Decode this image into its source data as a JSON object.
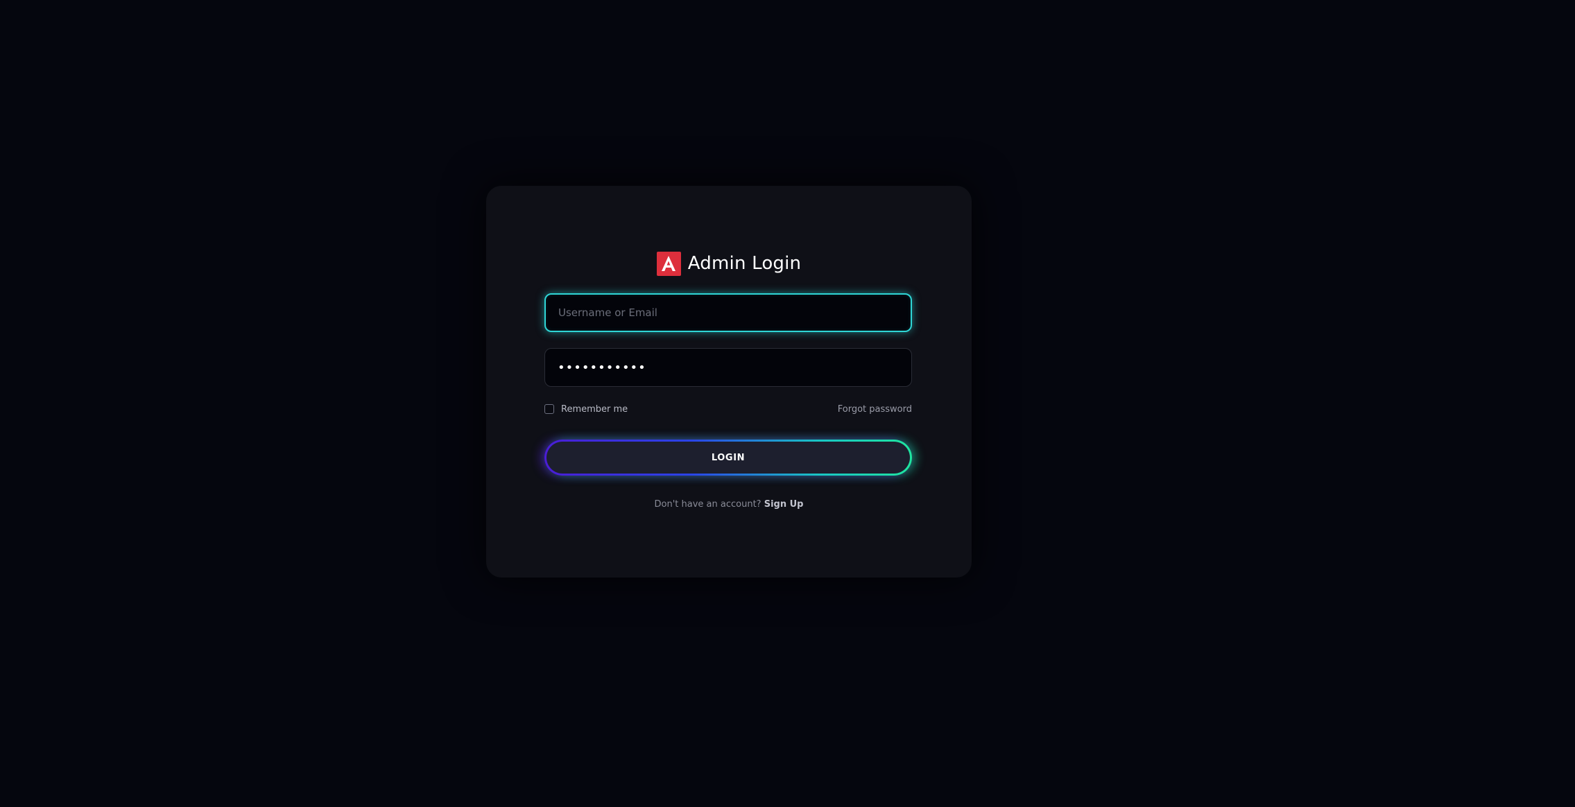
{
  "login_card": {
    "title": "Admin Login",
    "logo_icon": "angular-logo-icon",
    "accent_color": "#dd2f3c",
    "username": {
      "placeholder": "Username or Email",
      "value": ""
    },
    "password": {
      "value": "•••••••••••"
    },
    "remember_label": "Remember me",
    "remember_checked": false,
    "forgot_label": "Forgot password",
    "login_label": "LOGIN",
    "signup_prompt": "Don't have an account?",
    "signup_label": "Sign Up",
    "focus_color": "#2fd6d6",
    "button_gradient": [
      "#4a1dd6",
      "#2a44e8",
      "#19c7c4",
      "#1fe5a0"
    ]
  }
}
